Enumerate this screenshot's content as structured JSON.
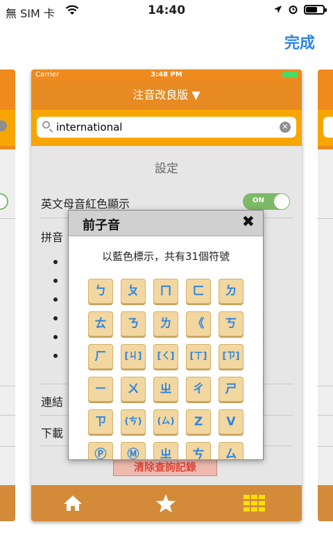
{
  "status_bar": {
    "carrier": "無 SIM 卡",
    "time": "14:40"
  },
  "top_action": {
    "done_label": "完成"
  },
  "app": {
    "mini_status": {
      "carrier": "Carrier",
      "time": "3:48 PM"
    },
    "nav_title": "注音改良版 ▼",
    "search": {
      "value": "international"
    },
    "settings_title": "設定",
    "vowel_row_label": "英文母音紅色顯示",
    "vowel_toggle": {
      "label": "ON",
      "state": "on"
    },
    "pinyin_row_label": "拼音",
    "link_row_label": "連結",
    "download_row_label": "下載",
    "clear_history_label": "清除查詢記錄",
    "tabs": [
      {
        "icon": "home-icon"
      },
      {
        "icon": "star-icon"
      },
      {
        "icon": "grid-icon"
      }
    ]
  },
  "popup": {
    "title": "前子音",
    "description": "以藍色標示，共有31個符號",
    "keys": [
      "ㄅ",
      "ㄆ",
      "ㄇ",
      "ㄈ",
      "ㄉ",
      "ㄊ",
      "ㄋ",
      "ㄌ",
      "《",
      "ㄎ",
      "ㄏ",
      "[ㄐ]",
      "[ㄑ]",
      "[ㄒ]",
      "[ㄗ]",
      "ㄧ",
      "ㄨ",
      "ㄓ",
      "ㄔ",
      "ㄕ",
      "ㄗ",
      "(ㄘ)",
      "(ㄙ)",
      "Z",
      "V",
      "Ⓟ",
      "Ⓜ",
      "ㄓ",
      "ㄘ",
      "ㄙ"
    ]
  },
  "colors": {
    "accent_orange": "#e78a22",
    "search_bar": "#f7a600",
    "link_blue": "#2b84e6",
    "key_text": "#2e86e0",
    "clear_red": "#e0483a"
  }
}
